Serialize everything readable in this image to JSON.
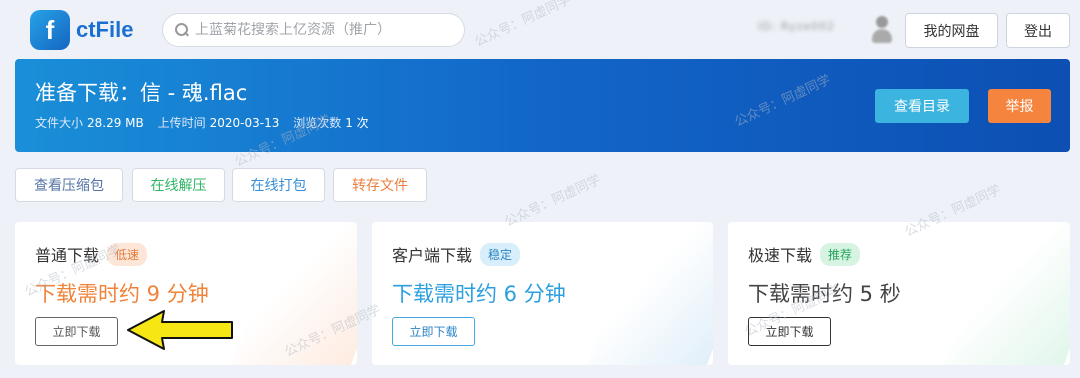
{
  "header": {
    "logo_text": "ctFile",
    "search_placeholder": "上蓝菊花搜索上亿资源（推广）",
    "user_name": "ID: Ryze002",
    "my_disk_label": "我的网盘",
    "logout_label": "登出"
  },
  "banner": {
    "title": "准备下载：信 - 魂.flac",
    "size_label": "文件大小",
    "size_value": "28.29 MB",
    "upload_label": "上传时间",
    "upload_value": "2020-03-13",
    "views_label": "浏览次数",
    "views_value": "1 次",
    "view_dir_label": "查看目录",
    "report_label": "举报",
    "accent_color": "#1266c8",
    "report_color": "#f5843e"
  },
  "actions": [
    {
      "label": "查看压缩包"
    },
    {
      "label": "在线解压"
    },
    {
      "label": "在线打包"
    },
    {
      "label": "转存文件"
    }
  ],
  "cards": [
    {
      "title": "普通下载",
      "tag": "低速",
      "time": "下载需时约 9 分钟",
      "button": "立即下载",
      "color": "#f0833a"
    },
    {
      "title": "客户端下载",
      "tag": "稳定",
      "time": "下载需时约 6 分钟",
      "button": "立即下载",
      "color": "#2b9fe0"
    },
    {
      "title": "极速下载",
      "tag": "推荐",
      "time": "下载需时约 5 秒",
      "button": "立即下载",
      "color": "#444444"
    }
  ],
  "annotation": {
    "arrow_icon": "yellow-arrow-left",
    "arrow_color": "#f5e614"
  },
  "watermark": "公众号：阿虚同学"
}
